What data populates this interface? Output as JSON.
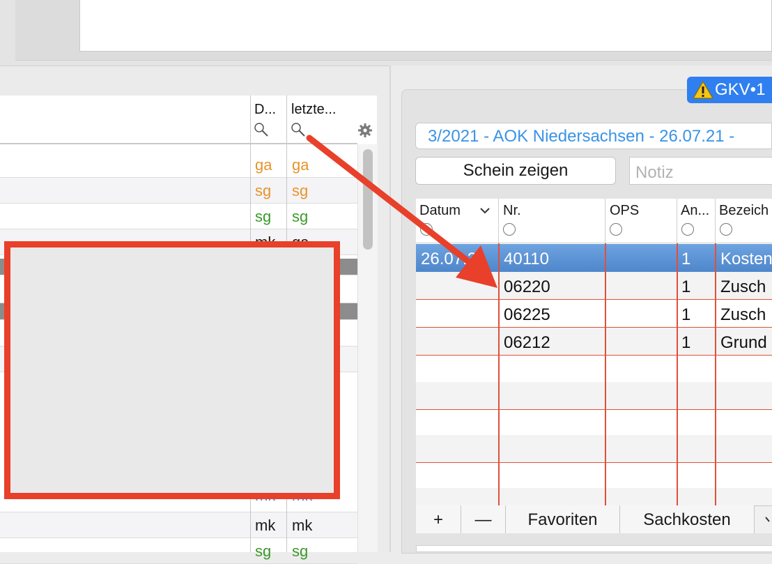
{
  "left_table": {
    "headers": {
      "col_d": "D...",
      "col_letzte": "letzte..."
    },
    "rows": [
      {
        "d": "ga",
        "l": "ga",
        "color": "#e8932a"
      },
      {
        "d": "sg",
        "l": "sg",
        "color": "#e8932a"
      },
      {
        "d": "sg",
        "l": "sg",
        "color": "#3a9a2a"
      },
      {
        "d": "mk",
        "l": "ga",
        "color": "#1a1a1a"
      },
      {
        "d": "mk",
        "l": "mk",
        "color": "#3a93e6"
      },
      {
        "d": "mk",
        "l": "mk",
        "color": "#1a1a1a"
      },
      {
        "d": "sg",
        "l": "sg",
        "color": "#3a9a2a"
      }
    ]
  },
  "right": {
    "badge": "GKV•1",
    "schein": "3/2021 - AOK Niedersachsen - 26.07.21 - ",
    "schein_button": "Schein zeigen",
    "notiz_placeholder": "Notiz",
    "columns": {
      "datum": "Datum",
      "nr": "Nr.",
      "ops": "OPS",
      "anzahl": "An...",
      "bezeichnung": "Bezeich"
    },
    "rows": [
      {
        "datum": "26.07.21",
        "nr": "40110",
        "ops": "",
        "anzahl": "1",
        "bez": "Kosten"
      },
      {
        "datum": "",
        "nr": "06220",
        "ops": "",
        "anzahl": "1",
        "bez": "Zusch"
      },
      {
        "datum": "",
        "nr": "06225",
        "ops": "",
        "anzahl": "1",
        "bez": "Zusch"
      },
      {
        "datum": "",
        "nr": "06212",
        "ops": "",
        "anzahl": "1",
        "bez": "Grund"
      }
    ],
    "bottom": {
      "plus": "+",
      "minus": "—",
      "favoriten": "Favoriten",
      "sachkosten": "Sachkosten"
    }
  },
  "colors": {
    "annotation_red": "#e8402a",
    "selection_blue": "#5c96d8",
    "badge_blue": "#2f7ff0",
    "link_blue": "#3a93e6"
  }
}
